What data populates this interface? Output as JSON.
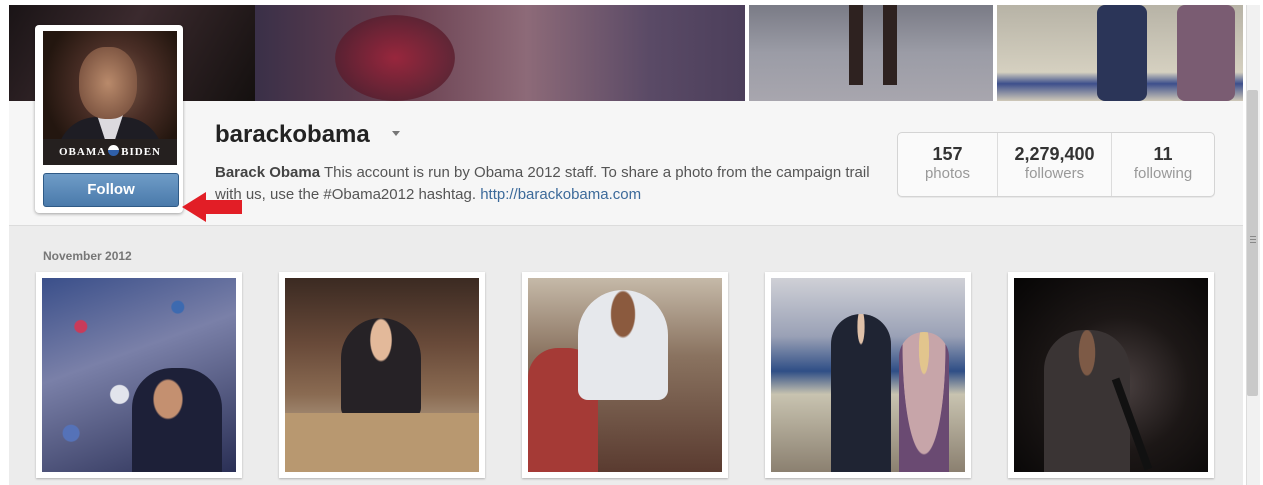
{
  "profile": {
    "username": "barackobama",
    "full_name": "Barack Obama",
    "bio": " This account is run by Obama 2012 staff. To share a photo from the campaign trail with us, use the #Obama2012 hashtag. ",
    "website": "http://barackobama.com",
    "avatar_banner_left": "OBAMA",
    "avatar_banner_right": "BIDEN",
    "follow_label": "Follow"
  },
  "stats": [
    {
      "value": "157",
      "label": "photos"
    },
    {
      "value": "2,279,400",
      "label": "followers"
    },
    {
      "value": "11",
      "label": "following"
    }
  ],
  "feed": {
    "month_heading": "November 2012"
  },
  "colors": {
    "follow_button": "#4a7aab",
    "link": "#3c6a9a",
    "annotation_arrow": "#e21e26"
  }
}
